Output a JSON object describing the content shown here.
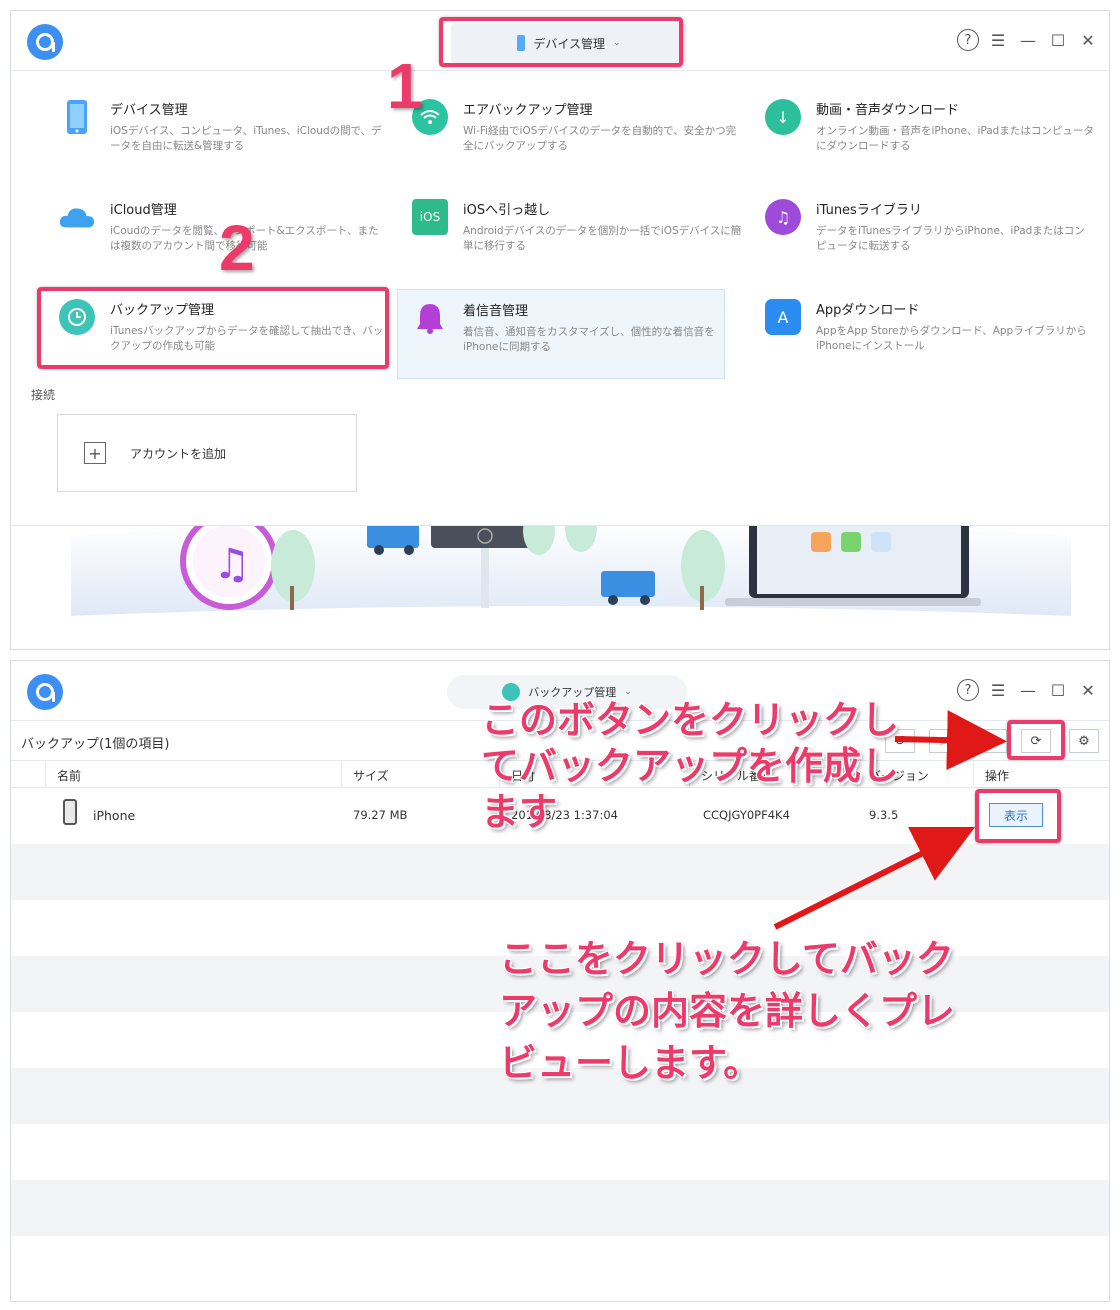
{
  "window1": {
    "device_selector_label": "デバイス管理",
    "step1": "1",
    "step2": "2",
    "features": [
      {
        "title": "デバイス管理",
        "desc": "iOSデバイス、コンピュータ、iTunes、iCloudの間で、データを自由に転送&管理する",
        "icon": "phone-icon"
      },
      {
        "title": "エアバックアップ管理",
        "desc": "Wi-Fi経由でiOSデバイスのデータを自動的で、安全かつ完全にバックアップする",
        "icon": "wifi-icon"
      },
      {
        "title": "動画・音声ダウンロード",
        "desc": "オンライン動画・音声をiPhone、iPadまたはコンピュータにダウンロードする",
        "icon": "download-icon"
      },
      {
        "title": "iCloud管理",
        "desc": "iCoudのデータを閲覧、インポート&エクスポート、または複数のアカウント間で移行可能",
        "icon": "cloud-icon"
      },
      {
        "title": "iOSへ引っ越し",
        "desc": "Androidデバイスのデータを個別か一括でiOSデバイスに簡単に移行する",
        "icon": "ios-icon"
      },
      {
        "title": "iTunesライブラリ",
        "desc": "データをiTunesライブラリからiPhone、iPadまたはコンピュータに転送する",
        "icon": "music-icon"
      },
      {
        "title": "バックアップ管理",
        "desc": "iTunesバックアップからデータを確認して抽出でき、バックアップの作成も可能",
        "icon": "clock-icon"
      },
      {
        "title": "着信音管理",
        "desc": "着信音、通知音をカスタマイズし、個性的な着信音をiPhoneに同期する",
        "icon": "bell-icon"
      },
      {
        "title": "Appダウンロード",
        "desc": "AppをApp Storeからダウンロード、AppライブラリからiPhoneにインストール",
        "icon": "appstore-icon"
      }
    ],
    "connection_label": "接続",
    "add_account_label": "アカウントを追加"
  },
  "window2": {
    "selector_label": "バックアップ管理",
    "toolbar_title": "バックアップ(1個の項目)",
    "columns": [
      "名前",
      "サイズ",
      "日付",
      "シリアル番号",
      "バージョン",
      "操作"
    ],
    "rows": [
      {
        "name": "iPhone",
        "size": "79.27 MB",
        "date": "2018/8/23 1:37:04",
        "serial": "CCQJGY0PF4K4",
        "version": "9.3.5",
        "action": "表示"
      }
    ],
    "annotation_top": "このボタンをクリックしてバックアップを作成します",
    "annotation_bottom": "ここをクリックしてバックアップの内容を詳しくプレビューします。"
  },
  "colors": {
    "accent_red": "#ec3a6a",
    "brand_blue": "#3d8ff3",
    "highlight_bg": "#eef6fc"
  }
}
